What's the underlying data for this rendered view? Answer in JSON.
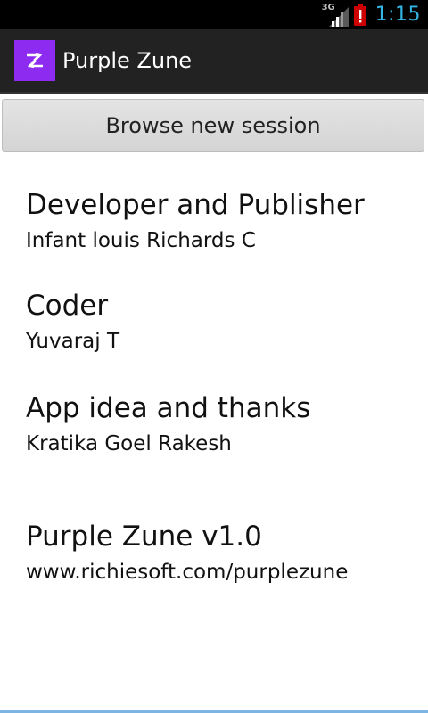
{
  "status_bar": {
    "network_label": "3G",
    "time": "1:15",
    "icons": [
      "signal-icon",
      "battery-alert-icon"
    ],
    "clock_color": "#33b5e5"
  },
  "action_bar": {
    "title": "Purple Zune",
    "icon": "shuffle-icon",
    "icon_color": "#8e2bf0",
    "background": "#222222"
  },
  "browse_button": {
    "label": "Browse new session"
  },
  "credits": [
    {
      "heading": "Developer and Publisher",
      "value": "Infant louis Richards C"
    },
    {
      "heading": "Coder",
      "value": "Yuvaraj T"
    },
    {
      "heading": "App idea and thanks",
      "value": "Kratika Goel Rakesh"
    }
  ],
  "about": {
    "version": "Purple Zune v1.0",
    "website": "www.richiesoft.com/purplezune"
  }
}
